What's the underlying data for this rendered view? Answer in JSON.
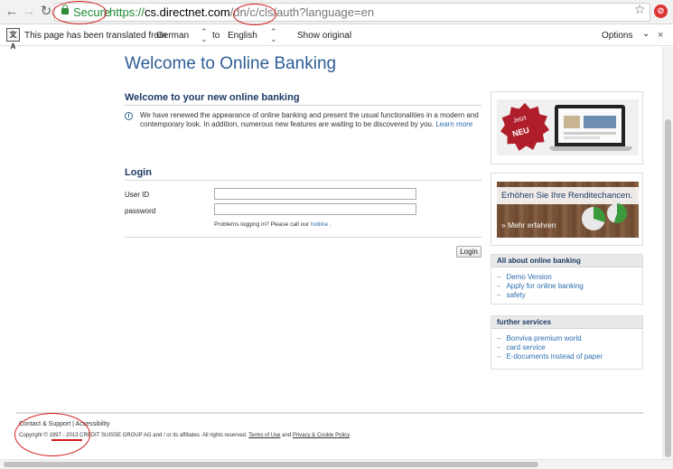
{
  "browser": {
    "secure_label": "Secure",
    "url_protocol": "https://",
    "url_host": "cs.directnet.com",
    "url_path": "/dn/c/cls/auth?language=en"
  },
  "translate_bar": {
    "message": "This page has been translated from",
    "from_language": "German",
    "to_word": "to",
    "to_language": "English",
    "show_original": "Show original",
    "options": "Options"
  },
  "page": {
    "title": "Welcome to Online Banking",
    "intro_heading": "Welcome to your new online banking",
    "intro_text": "We have renewed the appearance of online banking and present the usual functionalities in a modern and contemporary look. In addition, numerous new features are waiting to be discovered by you.",
    "learn_more": "Learn more"
  },
  "login": {
    "heading": "Login",
    "user_id_label": "User ID",
    "password_label": "password",
    "help_text": "Problems logging in? Please call our",
    "help_link": "hotline",
    "help_suffix": ".",
    "button": "Login"
  },
  "sidebar": {
    "promo1": {
      "badge_line1": "Jetzt",
      "badge_line2": "NEU"
    },
    "promo2": {
      "title": "Erhöhen Sie Ihre Renditechancen.",
      "link": "» Mehr erfahren"
    },
    "online_banking": {
      "title": "All about online banking",
      "links": [
        "Demo Version",
        "Apply for online banking",
        "safety"
      ]
    },
    "services": {
      "title": "further services",
      "links": [
        "Bonviva premium world",
        "card service",
        "E-documents instead of paper"
      ]
    }
  },
  "footer": {
    "contact": "Contact & Support",
    "separator": "|",
    "accessibility": "Accessibility",
    "copyright_prefix": "Copyright ©",
    "copyright_years": "1997 - 2013",
    "copyright_body": "CREDIT SUISSE GROUP AG and / or its affiliates. All rights reserved.",
    "terms": "Terms of Use",
    "and": "and",
    "privacy": "Privacy & Cookie Policy",
    "end": "."
  },
  "colors": {
    "accent": "#2d5e96",
    "annotation": "#d41c1c",
    "secure_green": "#1e8a32"
  }
}
